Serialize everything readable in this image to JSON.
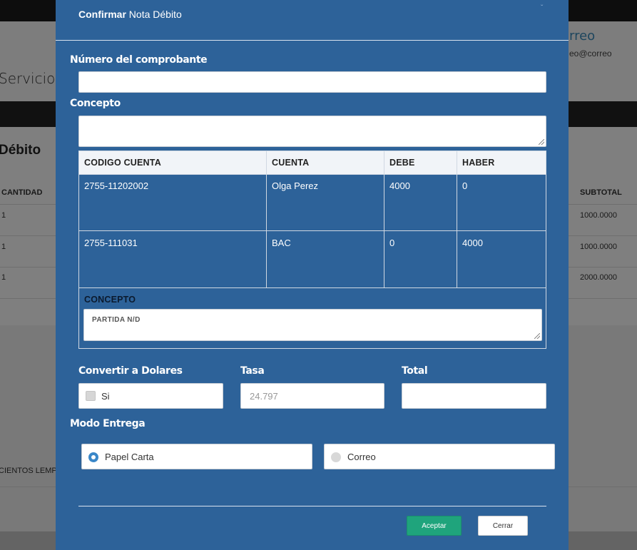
{
  "background": {
    "page_title": "Servicio",
    "user_name": "rreo",
    "user_email": "eo@correo",
    "section_title": "Débito",
    "table": {
      "headers": {
        "cantidad": "CANTIDAD",
        "subtotal": "SUBTOTAL"
      },
      "rows": [
        {
          "cantidad": "1",
          "subtotal": "1000.0000"
        },
        {
          "cantidad": "1",
          "subtotal": "1000.0000"
        },
        {
          "cantidad": "1",
          "subtotal": "2000.0000"
        }
      ]
    },
    "amount_words": "CIENTOS LEMPI"
  },
  "modal": {
    "title_bold": "Confirmar",
    "title_rest": " Nota Débito",
    "close_glyph": "ˇ",
    "comprobante": {
      "label": "Número del comprobante",
      "value": ""
    },
    "concepto": {
      "label": "Concepto",
      "value": ""
    },
    "table": {
      "headers": [
        "CODIGO CUENTA",
        "CUENTA",
        "DEBE",
        "HABER"
      ],
      "rows": [
        [
          "2755-11202002",
          "Olga Perez",
          "4000",
          "0"
        ],
        [
          "2755-111031",
          "BAC",
          "0",
          "4000"
        ]
      ],
      "concepto_label": "CONCEPTO",
      "concepto_value": "PARTIDA N/D"
    },
    "convertir": {
      "label": "Convertir a Dolares",
      "option": "Si",
      "checked": false
    },
    "tasa": {
      "label": "Tasa",
      "value": "24.797"
    },
    "total": {
      "label": "Total",
      "value": ""
    },
    "modo_entrega": {
      "label": "Modo Entrega",
      "options": [
        {
          "label": "Papel Carta",
          "selected": true
        },
        {
          "label": "Correo",
          "selected": false
        }
      ]
    },
    "buttons": {
      "accept": "Aceptar",
      "close": "Cerrar"
    },
    "colors": {
      "modal_bg": "#2d6299",
      "accept_btn": "#1fa47c",
      "radio_accent": "#3a87c8"
    }
  }
}
